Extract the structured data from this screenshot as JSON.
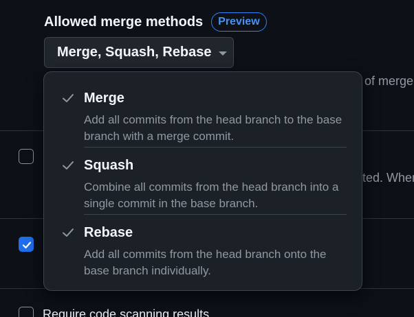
{
  "merge_methods": {
    "heading": "Allowed merge methods",
    "badge": "Preview",
    "selected_value": "Merge, Squash, Rebase"
  },
  "background": {
    "partial_text_1": "of merge",
    "partial_text_2": "ted. When",
    "partial_text_3": "Require code scanning results"
  },
  "menu": {
    "items": [
      {
        "label": "Merge",
        "description": "Add all commits from the head branch to the base branch with a merge commit.",
        "checked": true
      },
      {
        "label": "Squash",
        "description": "Combine all commits from the head branch into a single commit in the base branch.",
        "checked": true
      },
      {
        "label": "Rebase",
        "description": "Add all commits from the head branch onto the base branch individually.",
        "checked": true
      }
    ]
  },
  "colors": {
    "accent": "#1f6feb",
    "badge": "#4493f8",
    "background": "#0d1117",
    "menu_background": "#1c2128"
  }
}
